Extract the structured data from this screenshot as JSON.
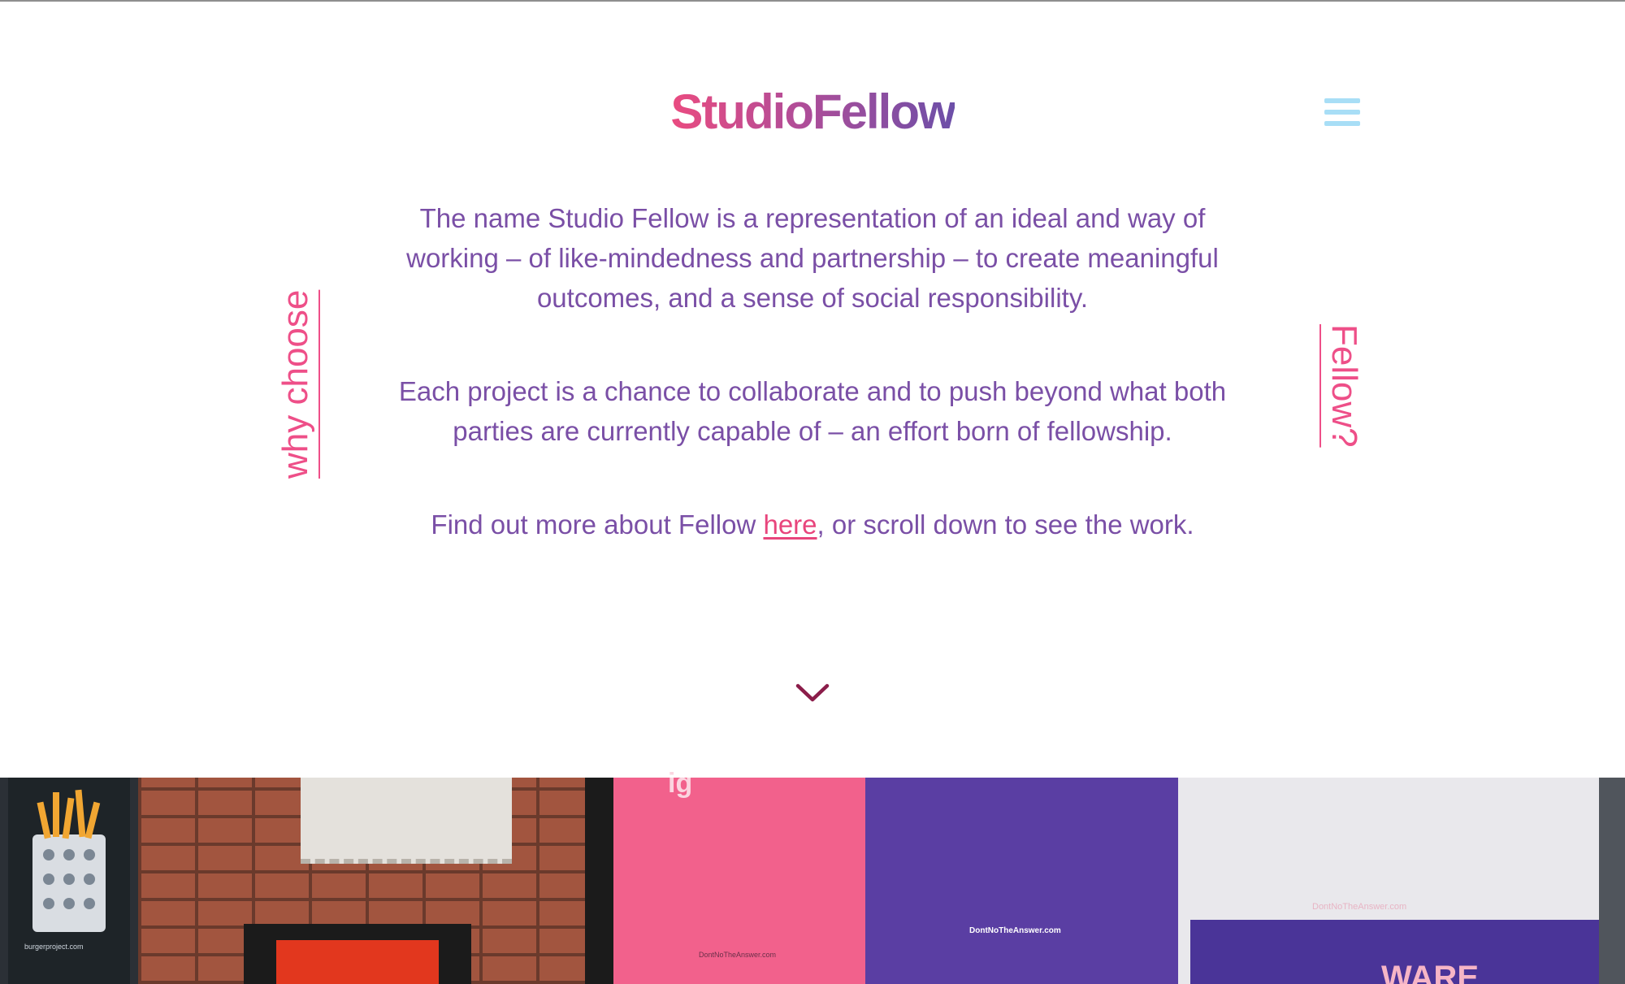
{
  "header": {
    "logo_text": "StudioFellow",
    "menu_icon": "hamburger-menu-icon"
  },
  "side_labels": {
    "left": "why choose",
    "right": "Fellow?"
  },
  "intro": {
    "paragraph_1": "The name Studio Fellow is a representation of an ideal and way of working – of like-mindedness and partnership – to create meaningful outcomes, and a sense of social responsibility.",
    "paragraph_2": "Each project is a chance to collaborate and to push beyond what both parties are currently capable of – an effort born of fellowship.",
    "paragraph_3_before": "Find out more about Fellow ",
    "paragraph_3_link": "here",
    "paragraph_3_after": ", or scroll down to see the work."
  },
  "scroll_down": {
    "icon": "chevron-down-icon"
  },
  "photo": {
    "poster_text_top": "ig",
    "poster_site_1": "DontNoTheAnswer.com",
    "poster_site_2": "DontNoTheAnswer.com",
    "poster_site_3": "DontNoTheAnswer.com",
    "poster_word": "WARE",
    "fries_poster_text": "burgerproject.com"
  },
  "colors": {
    "logo_start": "#ea4b80",
    "logo_end": "#6c4fa8",
    "body_text": "#7a4fa6",
    "accent_pink": "#ee4f88",
    "menu_icon": "#a8def6",
    "chevron": "#8b1d4a"
  }
}
